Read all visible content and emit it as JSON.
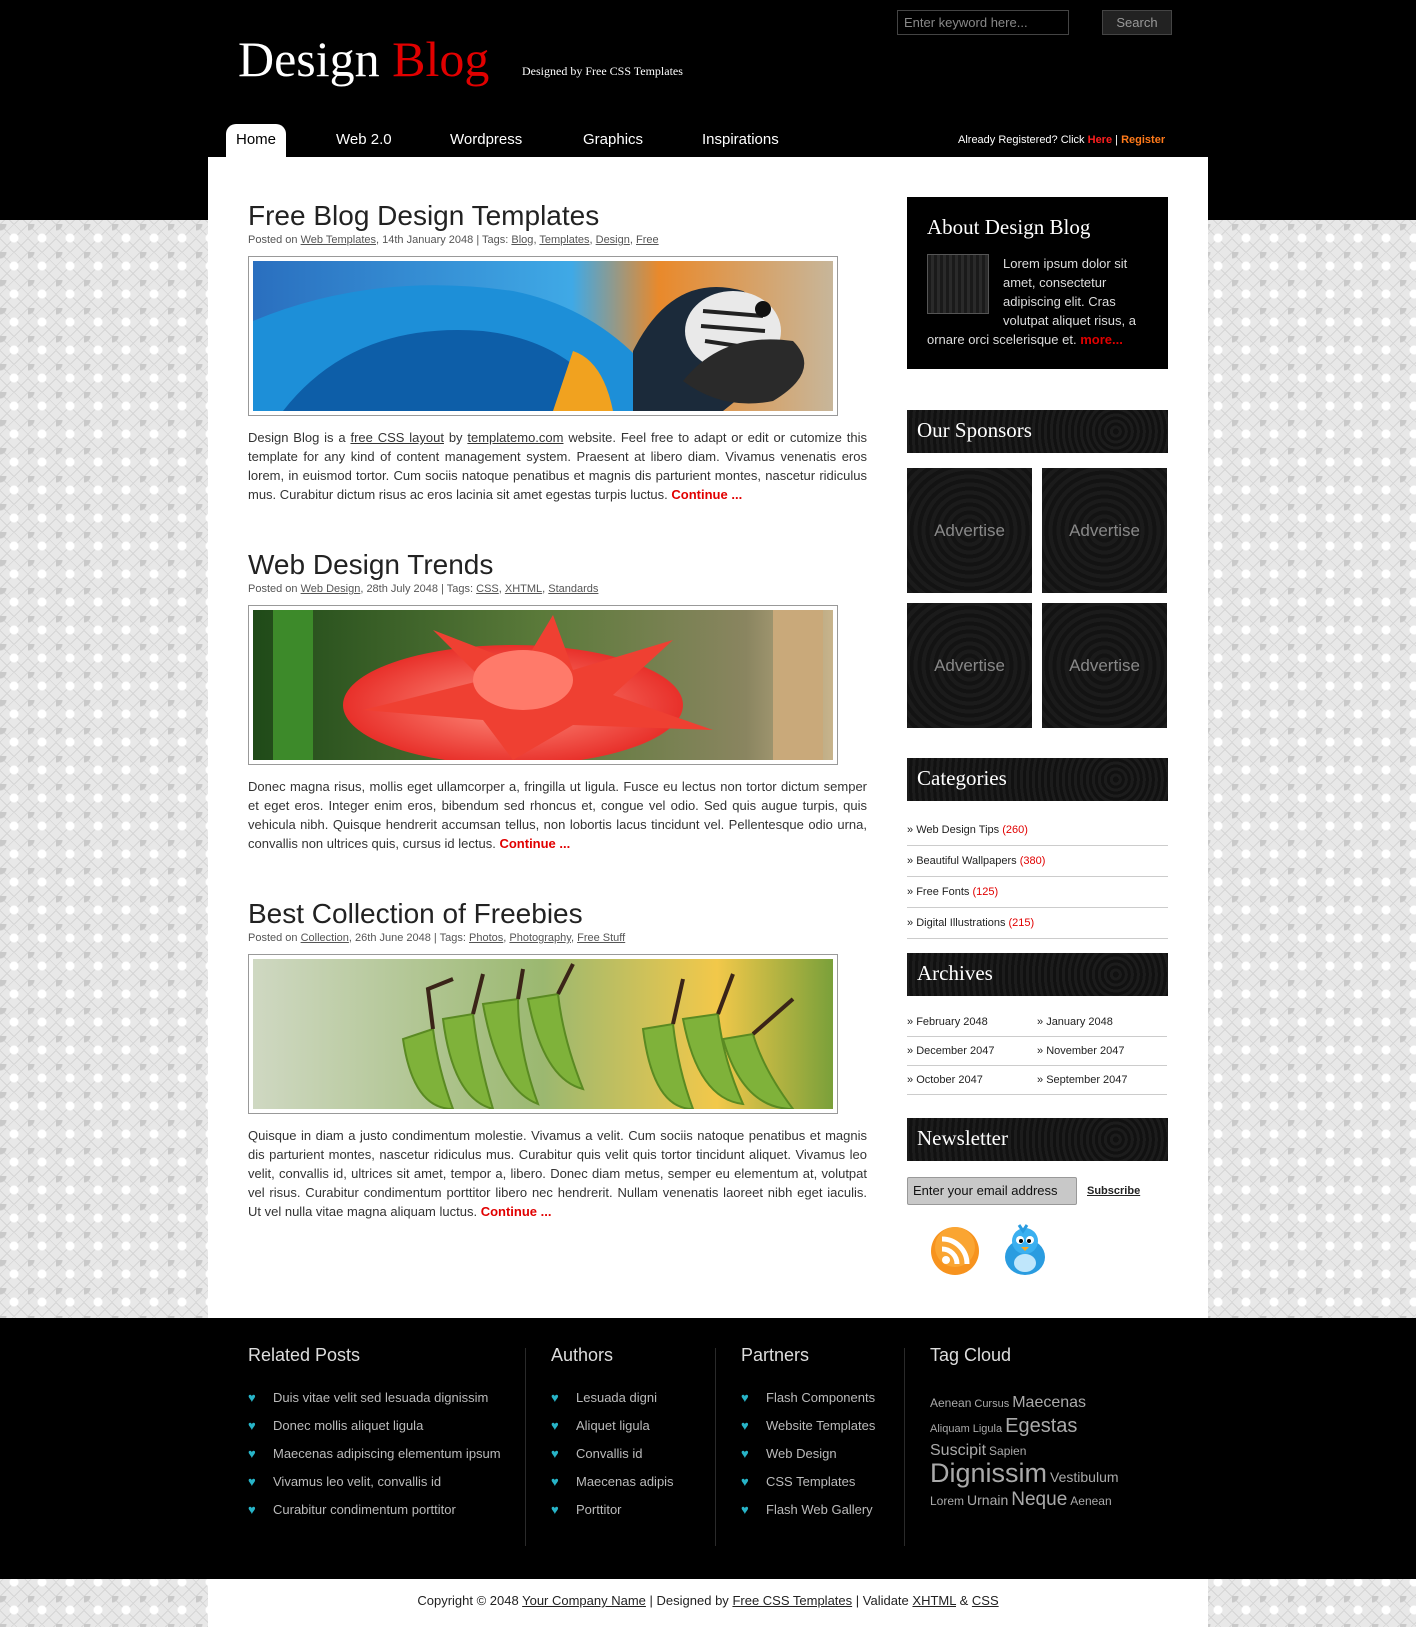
{
  "header": {
    "logo_part1": "Design",
    "logo_part2": "Blog",
    "tagline": "Designed by Free CSS Templates",
    "search_placeholder": "Enter keyword here...",
    "search_button": "Search"
  },
  "nav": {
    "items": [
      "Home",
      "Web 2.0",
      "Wordpress",
      "Graphics",
      "Inspirations"
    ],
    "register_text": "Already Registered? Click",
    "here": "Here",
    "separator": "|",
    "register": "Register"
  },
  "posts": [
    {
      "title": "Free Blog Design Templates",
      "meta_prefix": "Posted on",
      "category": "Web Templates",
      "date": ", 14th January 2048 | Tags:",
      "tags": [
        "Blog",
        "Templates",
        "Design",
        "Free"
      ],
      "text_a": "Design Blog is a",
      "link1": "free CSS layout",
      "text_b": "by",
      "link2": "templatemo.com",
      "text_c": "website. Feel free to adapt or edit or cutomize this template for any kind of content management system. Praesent at libero diam. Vivamus venenatis eros lorem, in euismod tortor. Cum sociis natoque penatibus et magnis dis parturient montes, nascetur ridiculus mus. Curabitur dictum risus ac eros lacinia sit amet egestas turpis luctus.",
      "continue": "Continue ..."
    },
    {
      "title": "Web Design Trends",
      "meta_prefix": "Posted on",
      "category": "Web Design",
      "date": ", 28th July 2048 | Tags:",
      "tags": [
        "CSS",
        "XHTML",
        "Standards"
      ],
      "text": "Donec magna risus, mollis eget ullamcorper a, fringilla ut ligula. Fusce eu lectus non tortor dictum semper et eget eros. Integer enim eros, bibendum sed rhoncus et, congue vel odio. Sed quis augue turpis, quis vehicula nibh. Quisque hendrerit accumsan tellus, non lobortis lacus tincidunt vel. Pellentesque odio urna, convallis non ultrices quis, cursus id lectus.",
      "continue": "Continue ..."
    },
    {
      "title": "Best Collection of Freebies",
      "meta_prefix": "Posted on",
      "category": "Collection",
      "date": ", 26th June 2048 | Tags:",
      "tags": [
        "Photos",
        "Photography",
        "Free Stuff"
      ],
      "text": "Quisque in diam a justo condimentum molestie. Vivamus a velit. Cum sociis natoque penatibus et magnis dis parturient montes, nascetur ridiculus mus. Curabitur quis velit quis tortor tincidunt aliquet. Vivamus leo velit, convallis id, ultrices sit amet, tempor a, libero. Donec diam metus, semper eu elementum at, volutpat vel risus. Curabitur condimentum porttitor libero nec hendrerit. Nullam venenatis laoreet nibh eget iaculis. Ut vel nulla vitae magna aliquam luctus.",
      "continue": "Continue ..."
    }
  ],
  "sidebar": {
    "about_title": "About Design Blog",
    "about_text": "Lorem ipsum dolor sit amet, consectetur adipiscing elit. Cras volutpat aliquet risus, a ornare orci scelerisque et.",
    "about_more": "more...",
    "sponsors_title": "Our Sponsors",
    "advertise": "Advertise",
    "categories_title": "Categories",
    "categories": [
      {
        "name": "Web Design Tips",
        "count": "(260)"
      },
      {
        "name": "Beautiful Wallpapers",
        "count": "(380)"
      },
      {
        "name": "Free Fonts",
        "count": "(125)"
      },
      {
        "name": "Digital Illustrations",
        "count": "(215)"
      }
    ],
    "archives_title": "Archives",
    "archives": [
      "February 2048",
      "January 2048",
      "December 2047",
      "November 2047",
      "October 2047",
      "September 2047"
    ],
    "newsletter_title": "Newsletter",
    "newsletter_placeholder": "Enter your email address",
    "subscribe": "Subscribe",
    "bullet": "»"
  },
  "footer": {
    "related_title": "Related Posts",
    "related": [
      "Duis vitae velit sed lesuada dignissim",
      "Donec mollis aliquet ligula",
      "Maecenas adipiscing elementum ipsum",
      "Vivamus leo velit, convallis id",
      "Curabitur condimentum porttitor"
    ],
    "authors_title": "Authors",
    "authors": [
      "Lesuada digni",
      "Aliquet ligula",
      "Convallis id",
      "Maecenas adipis",
      "Porttitor"
    ],
    "partners_title": "Partners",
    "partners": [
      "Flash Components",
      "Website Templates",
      "Web Design",
      "CSS Templates",
      "Flash Web Gallery"
    ],
    "tagcloud_title": "Tag Cloud",
    "tags": [
      "Aenean",
      "Cursus",
      "Maecenas",
      "Aliquam",
      "Ligula",
      "Egestas",
      "Suscipit",
      "Sapien",
      "Dignissim",
      "Vestibulum",
      "Lorem",
      "Urnain",
      "Neque",
      "Aenean"
    ],
    "heart": "♥",
    "copyright": "Copyright © 2048",
    "company": "Your Company Name",
    "designed_by": "| Designed by",
    "fct": "Free CSS Templates",
    "validate": "| Validate",
    "xhtml": "XHTML",
    "amp": "&",
    "css": "CSS"
  },
  "colors": {
    "accent_red": "#e10000",
    "orange": "#ff7a1a",
    "heart_cyan": "#27b4c8"
  }
}
